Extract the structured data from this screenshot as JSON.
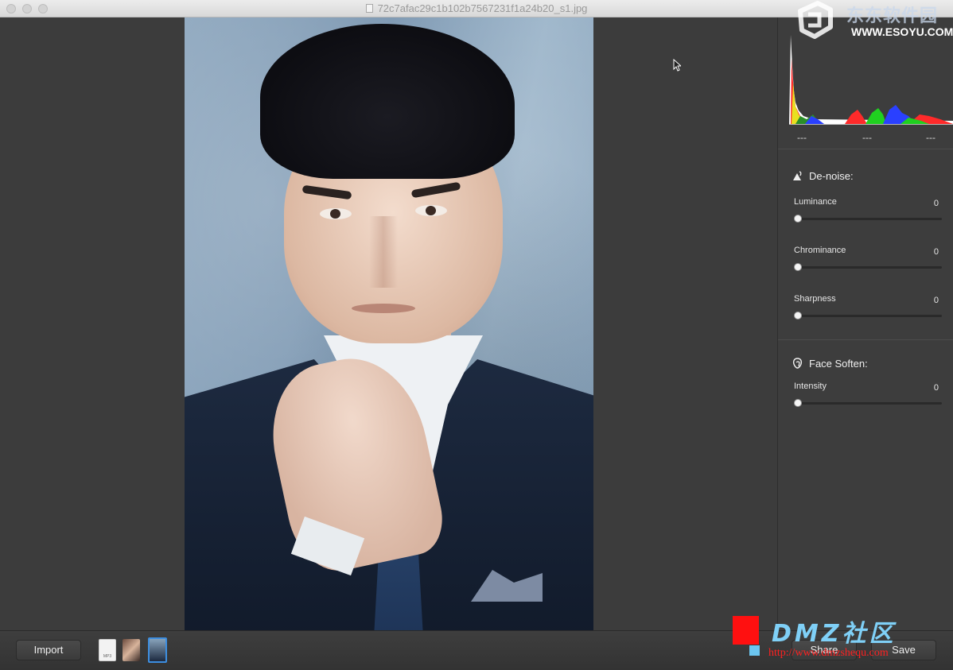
{
  "window": {
    "title": "72c7afac29c1b102b7567231f1a24b20_s1.jpg"
  },
  "histogram": {
    "labels": [
      "---",
      "---",
      "---"
    ],
    "colors": {
      "red": "#ff2020",
      "green": "#20d020",
      "blue": "#2040ff",
      "yellow": "#e8e020",
      "white": "#ffffff"
    }
  },
  "denoise": {
    "title": "De-noise:",
    "icon": "denoise-icon",
    "sliders": [
      {
        "label": "Luminance",
        "value": "0"
      },
      {
        "label": "Chrominance",
        "value": "0"
      },
      {
        "label": "Sharpness",
        "value": "0"
      }
    ]
  },
  "face_soften": {
    "title": "Face Soften:",
    "icon": "face-icon",
    "sliders": [
      {
        "label": "Intensity",
        "value": "0"
      }
    ]
  },
  "toolbar": {
    "import_label": "Import",
    "share_label": "Share",
    "save_label": "Save",
    "thumbnails": [
      {
        "name": "mp3-thumbnail",
        "caption": "MP3"
      },
      {
        "name": "photo-thumbnail-1",
        "caption": ""
      },
      {
        "name": "photo-thumbnail-2",
        "caption": ""
      }
    ]
  },
  "watermarks": {
    "top_brand": "东东软件园",
    "top_url": "WWW.ESOYU.COM",
    "bottom_brand": "DMZ社区",
    "bottom_url": "http://www.dmzshequ.com"
  },
  "colors": {
    "accent": "#3d8ee0",
    "panel_bg": "#3d3d3d",
    "canvas_bg": "#3c3c3c"
  }
}
